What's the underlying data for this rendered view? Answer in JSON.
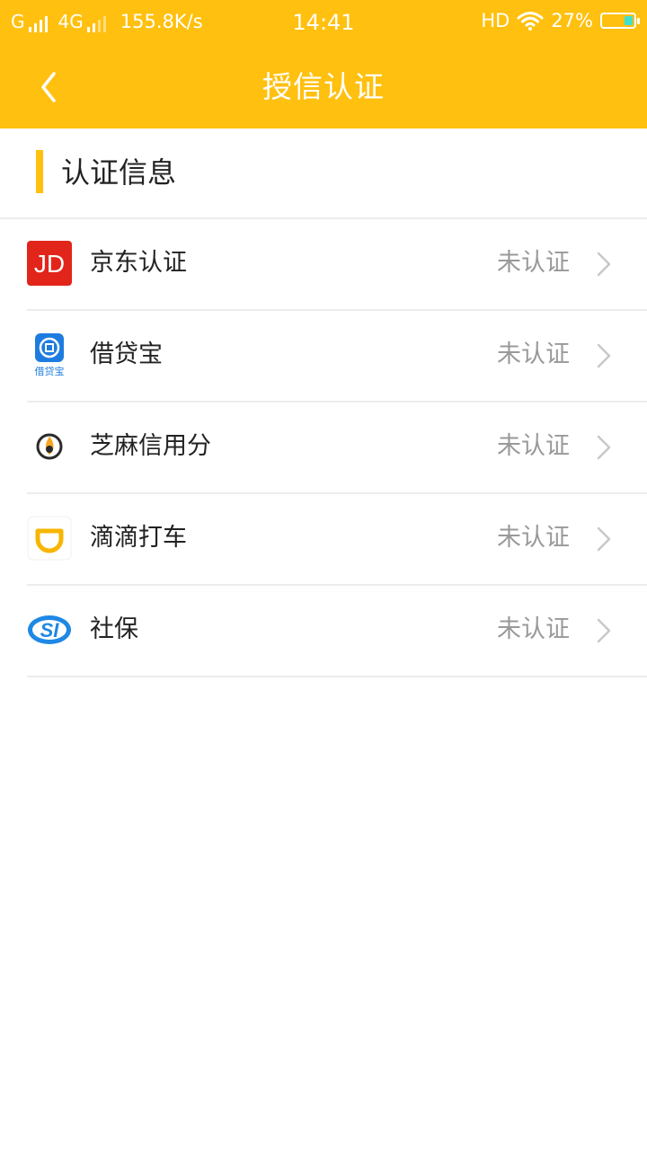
{
  "status_bar": {
    "signal1": "G",
    "signal2": "4G",
    "speed": "155.8K/s",
    "time": "14:41",
    "hd": "HD",
    "battery": "27%",
    "battery_level": 0.27,
    "battery_color": "#40E0D0"
  },
  "header": {
    "title": "授信认证",
    "back_icon": "chevron-left-icon",
    "background": "#FFC00F"
  },
  "section": {
    "title": "认证信息",
    "accent": "#FFC00F"
  },
  "items": [
    {
      "label": "京东认证",
      "status": "未认证",
      "icon": "jd-logo-icon"
    },
    {
      "label": "借贷宝",
      "status": "未认证",
      "icon": "jiedaibao-logo-icon"
    },
    {
      "label": "芝麻信用分",
      "status": "未认证",
      "icon": "zhima-credit-logo-icon"
    },
    {
      "label": "滴滴打车",
      "status": "未认证",
      "icon": "didi-logo-icon"
    },
    {
      "label": "社保",
      "status": "未认证",
      "icon": "social-security-logo-icon"
    }
  ],
  "icon_text": {
    "jd": "JD",
    "jiedaibao": "借贷宝",
    "shebao": "SI"
  }
}
